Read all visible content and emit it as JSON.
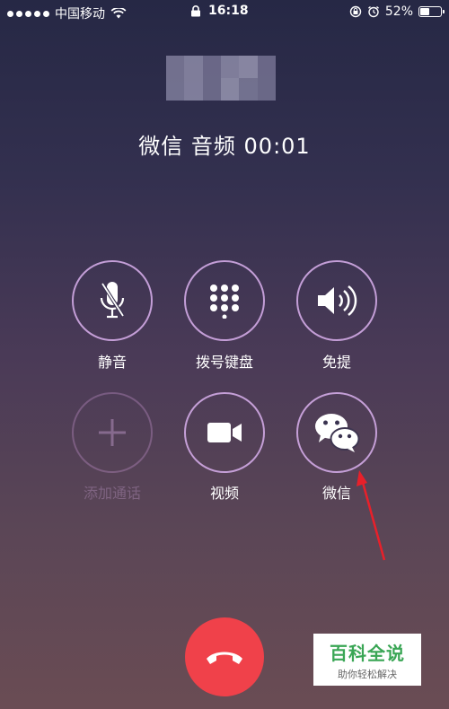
{
  "status_bar": {
    "carrier": "中国移动",
    "time": "16:18",
    "battery": "52%",
    "battery_level": 0.52
  },
  "call": {
    "status_text": "微信 音频 00:01"
  },
  "controls": [
    {
      "label": "静音",
      "icon": "microphone-off-icon",
      "enabled": true
    },
    {
      "label": "拨号键盘",
      "icon": "keypad-icon",
      "enabled": true
    },
    {
      "label": "免提",
      "icon": "speaker-icon",
      "enabled": true
    },
    {
      "label": "添加通话",
      "icon": "plus-icon",
      "enabled": false
    },
    {
      "label": "视频",
      "icon": "video-camera-icon",
      "enabled": true
    },
    {
      "label": "微信",
      "icon": "wechat-icon",
      "enabled": true
    }
  ],
  "end_call": {
    "icon": "hang-up-icon",
    "color": "#f0414a"
  },
  "annotation": {
    "icon": "red-arrow-icon",
    "color": "#e8202a"
  },
  "watermark": {
    "title": "百科全说",
    "subtitle": "助你轻松解决"
  }
}
